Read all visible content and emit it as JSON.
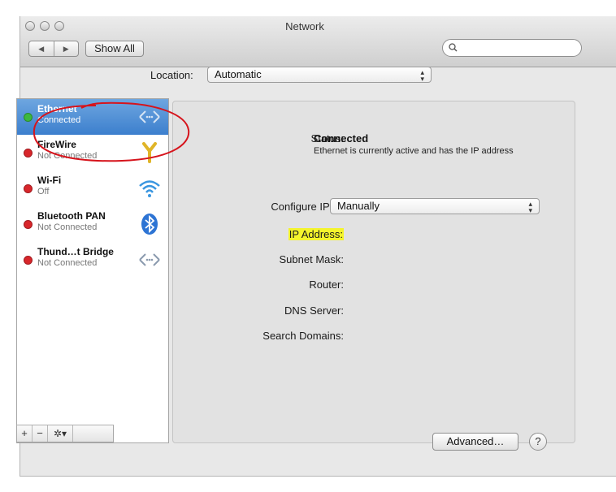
{
  "window": {
    "title": "Network"
  },
  "toolbar": {
    "back_label": "◀",
    "forward_label": "▶",
    "show_all_label": "Show All",
    "search_placeholder": ""
  },
  "location": {
    "label": "Location:",
    "value": "Automatic"
  },
  "services": [
    {
      "name": "Ethernet",
      "status": "Connected",
      "state_color": "#3db83d",
      "icon": "ethernet-arrows-icon"
    },
    {
      "name": "FireWire",
      "status": "Not Connected",
      "state_color": "#d8262b",
      "icon": "firewire-icon"
    },
    {
      "name": "Wi-Fi",
      "status": "Off",
      "state_color": "#d8262b",
      "icon": "wifi-icon"
    },
    {
      "name": "Bluetooth PAN",
      "status": "Not Connected",
      "state_color": "#d8262b",
      "icon": "bluetooth-icon"
    },
    {
      "name": "Thund…t Bridge",
      "status": "Not Connected",
      "state_color": "#d8262b",
      "icon": "thunderbolt-bridge-icon"
    }
  ],
  "sidebar_tools": {
    "add": "+",
    "remove": "−",
    "action": "✲▾"
  },
  "details": {
    "status_label": "Status:",
    "status_value": "Connected",
    "status_desc": "Ethernet is currently active and has the IP address",
    "configure_label": "Configure IPv4:",
    "configure_value": "Manually",
    "ip_label": "IP Address:",
    "subnet_label": "Subnet Mask:",
    "router_label": "Router:",
    "dns_label": "DNS Server:",
    "search_domains_label": "Search Domains:"
  },
  "buttons": {
    "advanced": "Advanced…",
    "help": "?"
  },
  "colors": {
    "selection": "#3c7fcd",
    "highlight": "#f4f42c",
    "annotation": "#d6141c"
  }
}
